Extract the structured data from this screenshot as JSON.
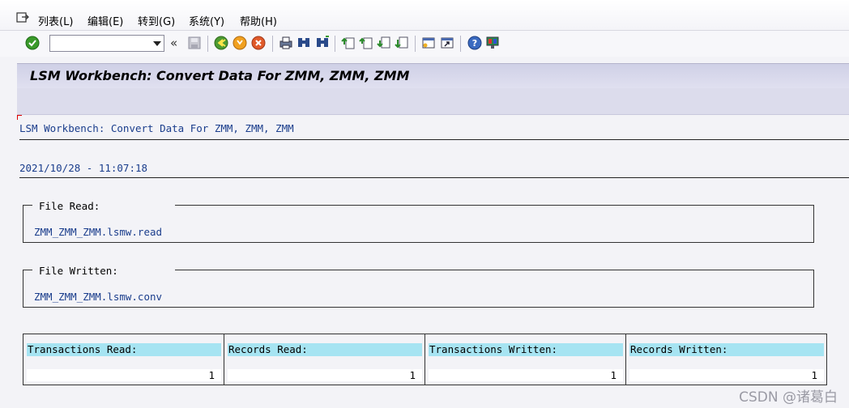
{
  "menu": {
    "items": [
      "列表(L)",
      "编辑(E)",
      "转到(G)",
      "系统(Y)",
      "帮助(H)"
    ]
  },
  "toolbar": {
    "command_field_value": "",
    "icons": [
      "enter-check-icon",
      "history-icon",
      "save-icon",
      "back-icon",
      "exit-icon",
      "cancel-icon",
      "print-icon",
      "find-icon",
      "find-next-icon",
      "first-page-icon",
      "previous-page-icon",
      "next-page-icon",
      "last-page-icon",
      "new-session-icon",
      "shortcut-icon",
      "help-icon",
      "customize-layout-icon"
    ]
  },
  "title": "LSM Workbench: Convert Data For ZMM, ZMM, ZMM",
  "content": {
    "header_line": "LSM Workbench: Convert Data For ZMM, ZMM, ZMM",
    "timestamp": "2021/10/28 - 11:07:18",
    "file_read": {
      "label": "File Read:",
      "value": "ZMM_ZMM_ZMM.lsmw.read"
    },
    "file_written": {
      "label": "File Written:",
      "value": "ZMM_ZMM_ZMM.lsmw.conv"
    },
    "stats": [
      {
        "label": "Transactions Read:",
        "value": "1"
      },
      {
        "label": "Records Read:",
        "value": "1"
      },
      {
        "label": "Transactions Written:",
        "value": "1"
      },
      {
        "label": "Records Written:",
        "value": "1"
      }
    ]
  },
  "watermark": "CSDN @诸葛白",
  "colors": {
    "title_bg": "#d8d8ec",
    "label_bg": "#a6e4f2",
    "text_blue": "#1a3d8c"
  }
}
